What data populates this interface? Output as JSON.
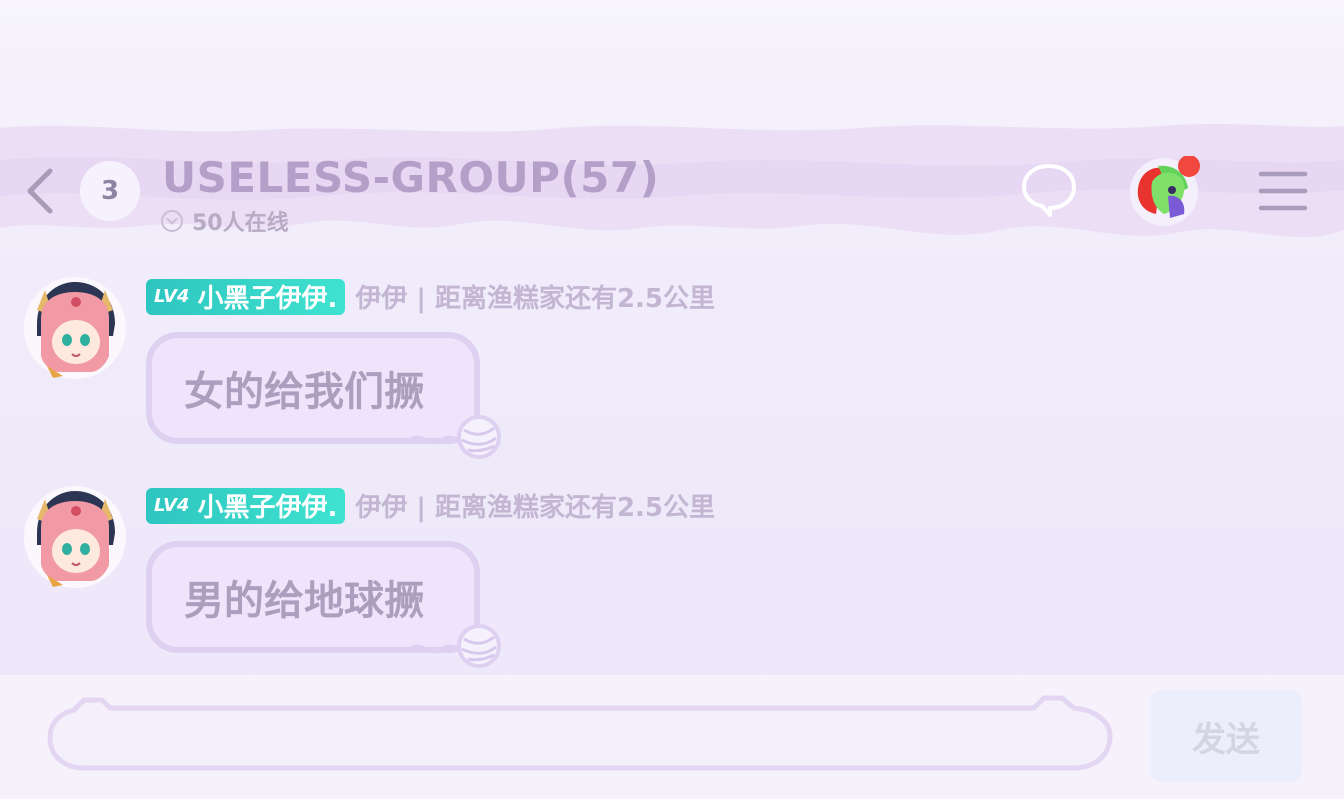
{
  "header": {
    "unread_count": "3",
    "title": "USELESS-GROUP(57)",
    "online_status": "50人在线",
    "icons": {
      "back": "chevron-left-icon",
      "status": "chevron-down-circle-icon",
      "chat": "speech-bubble-icon",
      "menu": "hamburger-menu-icon"
    },
    "notification_color": "#f0473e"
  },
  "messages": [
    {
      "level": "LV4",
      "nickname": "小黑子伊伊.",
      "subtitle": "伊伊 | 距离渔糕家还有2.5公里",
      "text": "女的给我们撅"
    },
    {
      "level": "LV4",
      "nickname": "小黑子伊伊.",
      "subtitle": "伊伊 | 距离渔糕家还有2.5公里",
      "text": "男的给地球撅"
    }
  ],
  "composer": {
    "placeholder": "",
    "send_label": "发送"
  },
  "colors": {
    "accent_purple": "#b49fc9",
    "badge_teal": "#2ec6c0",
    "bubble_border": "#ddd0f0"
  }
}
